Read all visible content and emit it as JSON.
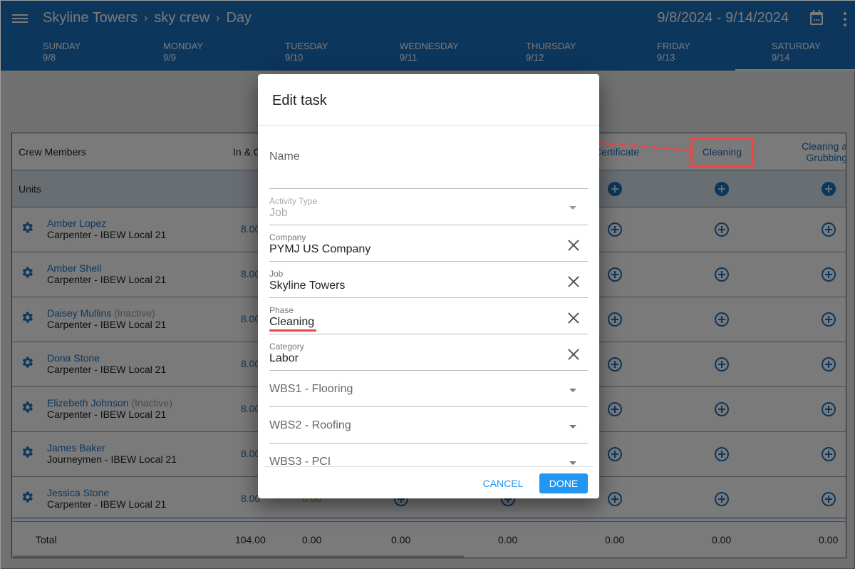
{
  "appbar": {
    "breadcrumbs": [
      "Skyline Towers",
      "sky crew",
      "Day"
    ],
    "date_range": "9/8/2024 - 9/14/2024",
    "tabs": [
      {
        "day": "SUNDAY",
        "date": "9/8"
      },
      {
        "day": "MONDAY",
        "date": "9/9"
      },
      {
        "day": "TUESDAY",
        "date": "9/10"
      },
      {
        "day": "WEDNESDAY",
        "date": "9/11"
      },
      {
        "day": "THURSDAY",
        "date": "9/12"
      },
      {
        "day": "FRIDAY",
        "date": "9/13"
      },
      {
        "day": "SATURDAY",
        "date": "9/14",
        "active": true
      }
    ]
  },
  "table": {
    "headers": {
      "crew": "Crew Members",
      "in_out": "In & C",
      "col_certificate": "Certificate",
      "col_cleaning": "Cleaning",
      "col_clearing": "Clearing a\nGrubbing"
    },
    "units_label": "Units",
    "rows": [
      {
        "name": "Amber Lopez",
        "status": "",
        "trade": "Carpenter - IBEW Local 21",
        "hours": "8.00"
      },
      {
        "name": "Amber Shell",
        "status": "",
        "trade": "Carpenter - IBEW Local 21",
        "hours": "8.00"
      },
      {
        "name": "Daisey Mullins",
        "status": "(Inactive)",
        "trade": "Carpenter - IBEW Local 21",
        "hours": "8.00"
      },
      {
        "name": "Dona Stone",
        "status": "",
        "trade": "Carpenter - IBEW Local 21",
        "hours": "8.00"
      },
      {
        "name": "Elizebeth Johnson",
        "status": "(Inactive)",
        "trade": "Carpenter - IBEW Local 21",
        "hours": "8.00"
      },
      {
        "name": "James Baker",
        "status": "",
        "trade": "Journeymen - IBEW Local 21",
        "hours": "8.00"
      },
      {
        "name": "Jessica Stone",
        "status": "",
        "trade": "Carpenter - IBEW Local 21",
        "hours": "8.00",
        "extra": "0.00"
      }
    ],
    "total": {
      "label": "Total",
      "values": [
        "104.00",
        "0.00",
        "0.00",
        "0.00",
        "0.00",
        "0.00",
        "0.00"
      ]
    }
  },
  "dialog": {
    "title": "Edit task",
    "fields": {
      "name": {
        "placeholder": "Name",
        "value": ""
      },
      "activity_type": {
        "label": "Activity Type",
        "value": "Job"
      },
      "company": {
        "label": "Company",
        "value": "PYMJ US Company"
      },
      "job": {
        "label": "Job",
        "value": "Skyline Towers"
      },
      "phase": {
        "label": "Phase",
        "value": "Cleaning"
      },
      "category": {
        "label": "Category",
        "value": "Labor"
      },
      "wbs1": {
        "placeholder": "WBS1 - Flooring"
      },
      "wbs2": {
        "placeholder": "WBS2 - Roofing"
      },
      "wbs3": {
        "placeholder": "WBS3 - PCI"
      }
    },
    "cancel_label": "Cancel",
    "done_label": "Done"
  },
  "colors": {
    "primary": "#1c72c2",
    "button": "#2196f3",
    "annotation": "#f04545",
    "warning_text": "#e09a1a"
  }
}
